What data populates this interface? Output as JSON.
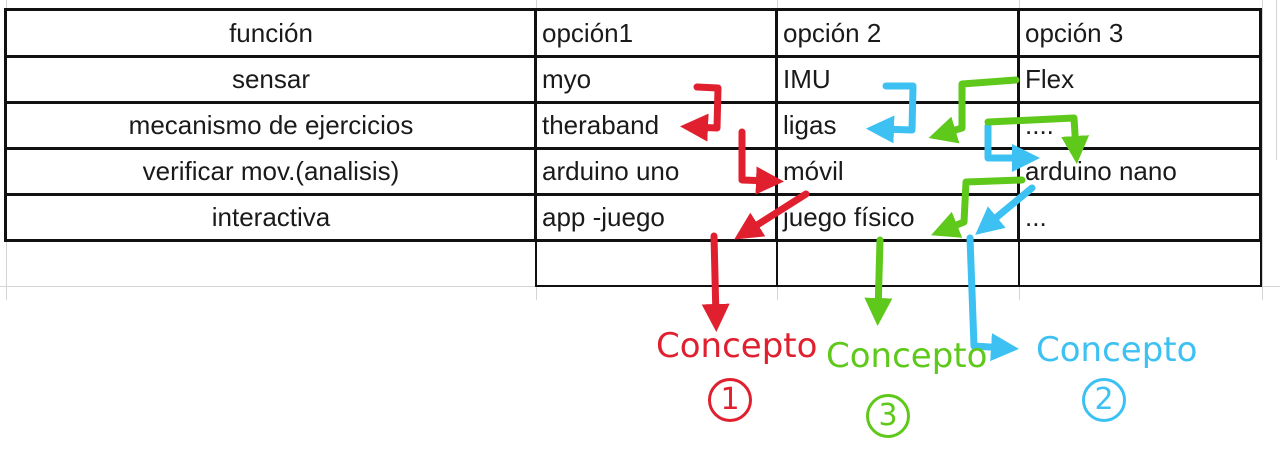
{
  "table": {
    "headers": [
      "función",
      "opción1",
      "opción 2",
      "opción 3"
    ],
    "rows": [
      [
        "sensar",
        "myo",
        "IMU",
        "Flex"
      ],
      [
        "mecanismo de ejercicios",
        "theraband",
        "ligas",
        "...."
      ],
      [
        "verificar mov.(analisis)",
        "arduino uno",
        "móvil",
        "arduino nano"
      ],
      [
        "interactiva",
        "app -juego",
        "juego físico",
        "..."
      ]
    ]
  },
  "concepts": [
    {
      "label": "Concepto",
      "number": "1",
      "color": "#e0202e"
    },
    {
      "label": "Concepto",
      "number": "2",
      "color": "#3cc1f2"
    },
    {
      "label": "Concepto",
      "number": "3",
      "color": "#5ec91a"
    }
  ]
}
